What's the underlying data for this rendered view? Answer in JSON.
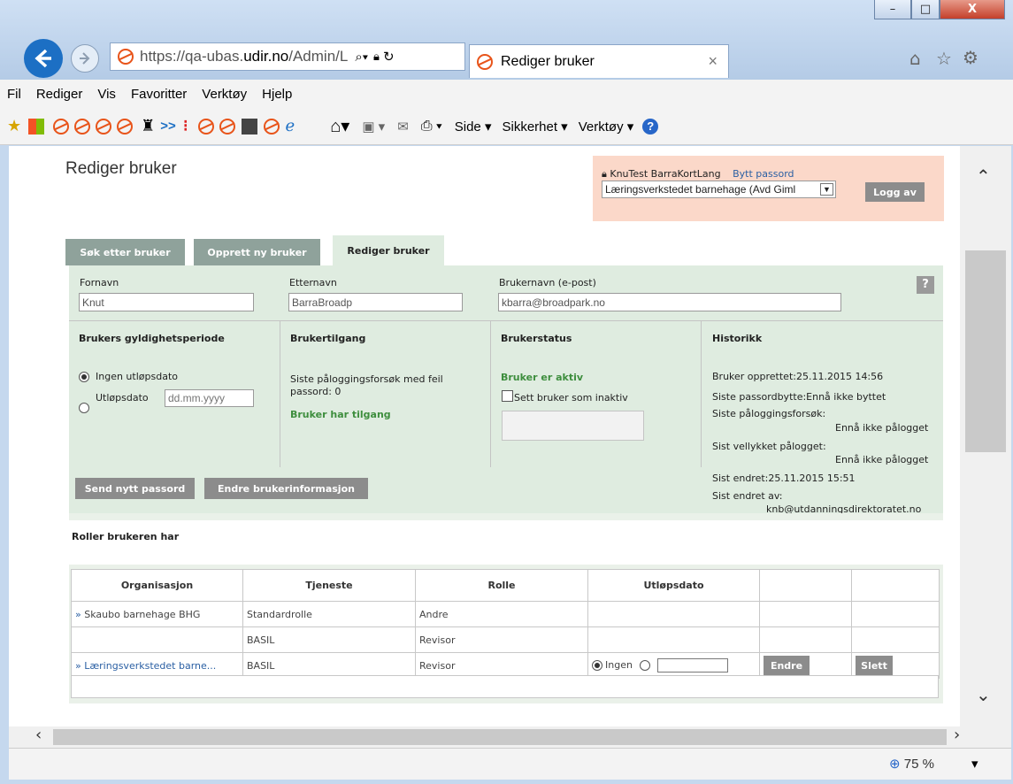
{
  "browser": {
    "address_scheme": "https://",
    "address_sub": "qa-ubas.",
    "address_domain": "udir.no",
    "address_path": "/Admin/L",
    "tab_title": "Rediger bruker",
    "tab_close": "×",
    "menu": [
      "Fil",
      "Rediger",
      "Vis",
      "Favoritter",
      "Verktøy",
      "Hjelp"
    ],
    "toolbar_more": ">>",
    "cmd": {
      "side": "Side",
      "sikkerhet": "Sikkerhet",
      "verktoy": "Verktøy"
    },
    "zoom": "75 %",
    "window_buttons": {
      "min": "–",
      "max": "□",
      "close": "X"
    }
  },
  "header": {
    "title": "Rediger bruker",
    "user_name": "KnuTest BarraKortLang",
    "change_password": "Bytt passord",
    "org_selected": "Læringsverkstedet barnehage (Avd Giml",
    "logout": "Logg av"
  },
  "tabs": [
    "Søk etter bruker",
    "Opprett ny bruker",
    "Rediger bruker"
  ],
  "form": {
    "first_name_label": "Fornavn",
    "first_name": "Knut",
    "last_name_label": "Etternavn",
    "last_name": "BarraBroadp",
    "username_label": "Brukernavn (e-post)",
    "username": "kbarra@broadpark.no",
    "help": "?"
  },
  "validity": {
    "heading": "Brukers gyldighetsperiode",
    "no_expiry": "Ingen utløpsdato",
    "expiry": "Utløpsdato",
    "date_placeholder": "dd.mm.yyyy"
  },
  "access": {
    "heading": "Brukertilgang",
    "failed_attempts": "Siste påloggingsforsøk med feil passord: 0",
    "status": "Bruker har tilgang"
  },
  "status": {
    "heading": "Brukerstatus",
    "active": "Bruker er aktiv",
    "set_inactive": "Sett bruker som inaktiv"
  },
  "history": {
    "heading": "Historikk",
    "created": "Bruker opprettet:25.11.2015 14:56",
    "last_pw_change": "Siste passordbytte:Ennå ikke byttet",
    "last_login_attempt_label": "Siste påloggingsforsøk:",
    "last_login_attempt": "Ennå ikke pålogget",
    "last_success_label": "Sist vellykket pålogget:",
    "last_success": "Ennå ikke pålogget",
    "last_changed": "Sist endret:25.11.2015 15:51",
    "changed_by_label": "Sist endret av:",
    "changed_by": "knb@utdanningsdirektoratet.no"
  },
  "actions": {
    "send_password": "Send nytt passord",
    "edit_info": "Endre brukerinformasjon"
  },
  "roles": {
    "heading": "Roller brukeren har",
    "columns": [
      "Organisasjon",
      "Tjeneste",
      "Rolle",
      "Utløpsdato",
      "",
      ""
    ],
    "rows": [
      {
        "org": "Skaubo barnehage BHG",
        "service": "Standardrolle",
        "role": "Andre"
      },
      {
        "org": "",
        "service": "BASIL",
        "role": "Revisor"
      },
      {
        "org": "Læringsverkstedet barne...",
        "service": "BASIL",
        "role": "Revisor",
        "expiry_none": "Ingen",
        "edit": "Endre",
        "delete": "Slett"
      }
    ]
  }
}
